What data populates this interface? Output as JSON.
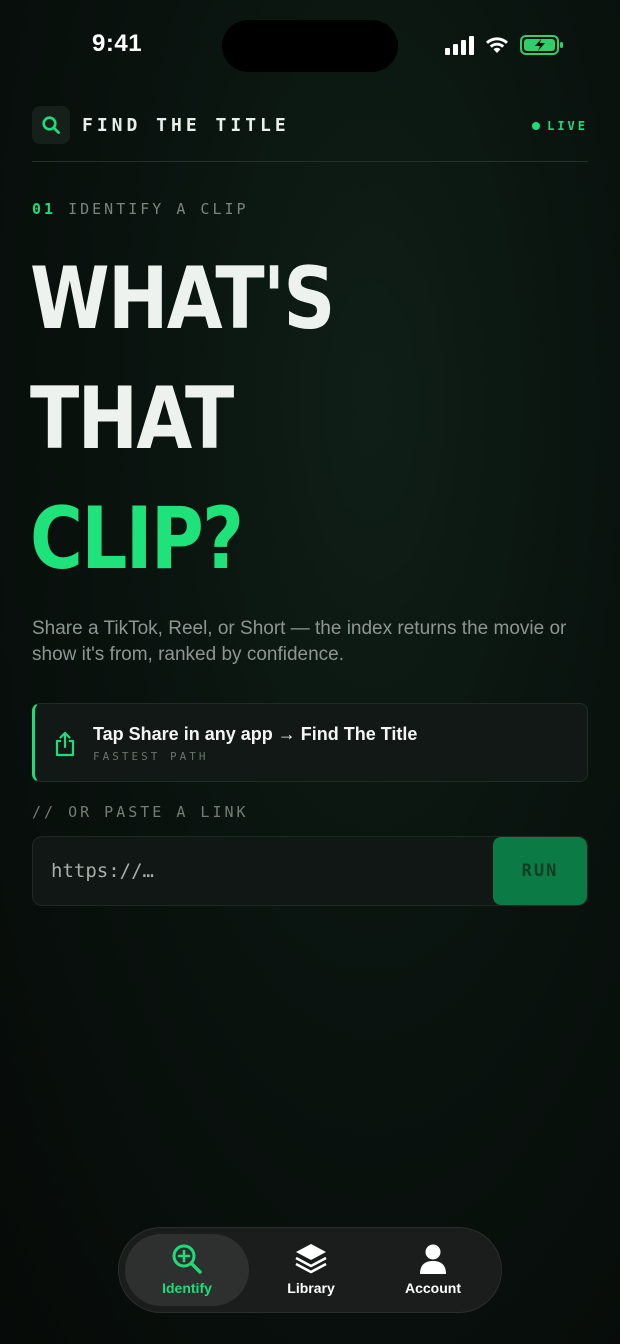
{
  "status_bar": {
    "time": "9:41"
  },
  "header": {
    "brand": "FIND THE TITLE",
    "live_label": "LIVE",
    "search_icon": "search-icon"
  },
  "hero": {
    "step_number": "01",
    "step_label": "IDENTIFY A CLIP",
    "headline_line1": "WHAT'S",
    "headline_line2": "THAT",
    "headline_line3": "CLIP?",
    "subtitle": "Share a TikTok, Reel, or Short — the index returns the movie or show it's from, ranked by confidence."
  },
  "share_card": {
    "icon": "share-icon",
    "title": "Tap Share in any app → Find The Title",
    "subtitle": "FASTEST PATH"
  },
  "paste": {
    "label": "// OR PASTE A LINK",
    "placeholder": "https://…",
    "value": "",
    "run_label": "RUN"
  },
  "tabbar": {
    "tabs": [
      {
        "label": "Identify",
        "icon": "identify-icon",
        "active": true
      },
      {
        "label": "Library",
        "icon": "library-icon",
        "active": false
      },
      {
        "label": "Account",
        "icon": "account-icon",
        "active": false
      }
    ]
  },
  "colors": {
    "accent": "#1fdc78",
    "background": "#0a130f",
    "run_button": "#0c7a44",
    "text_primary": "#eef2ef",
    "text_muted": "#8d9692"
  }
}
